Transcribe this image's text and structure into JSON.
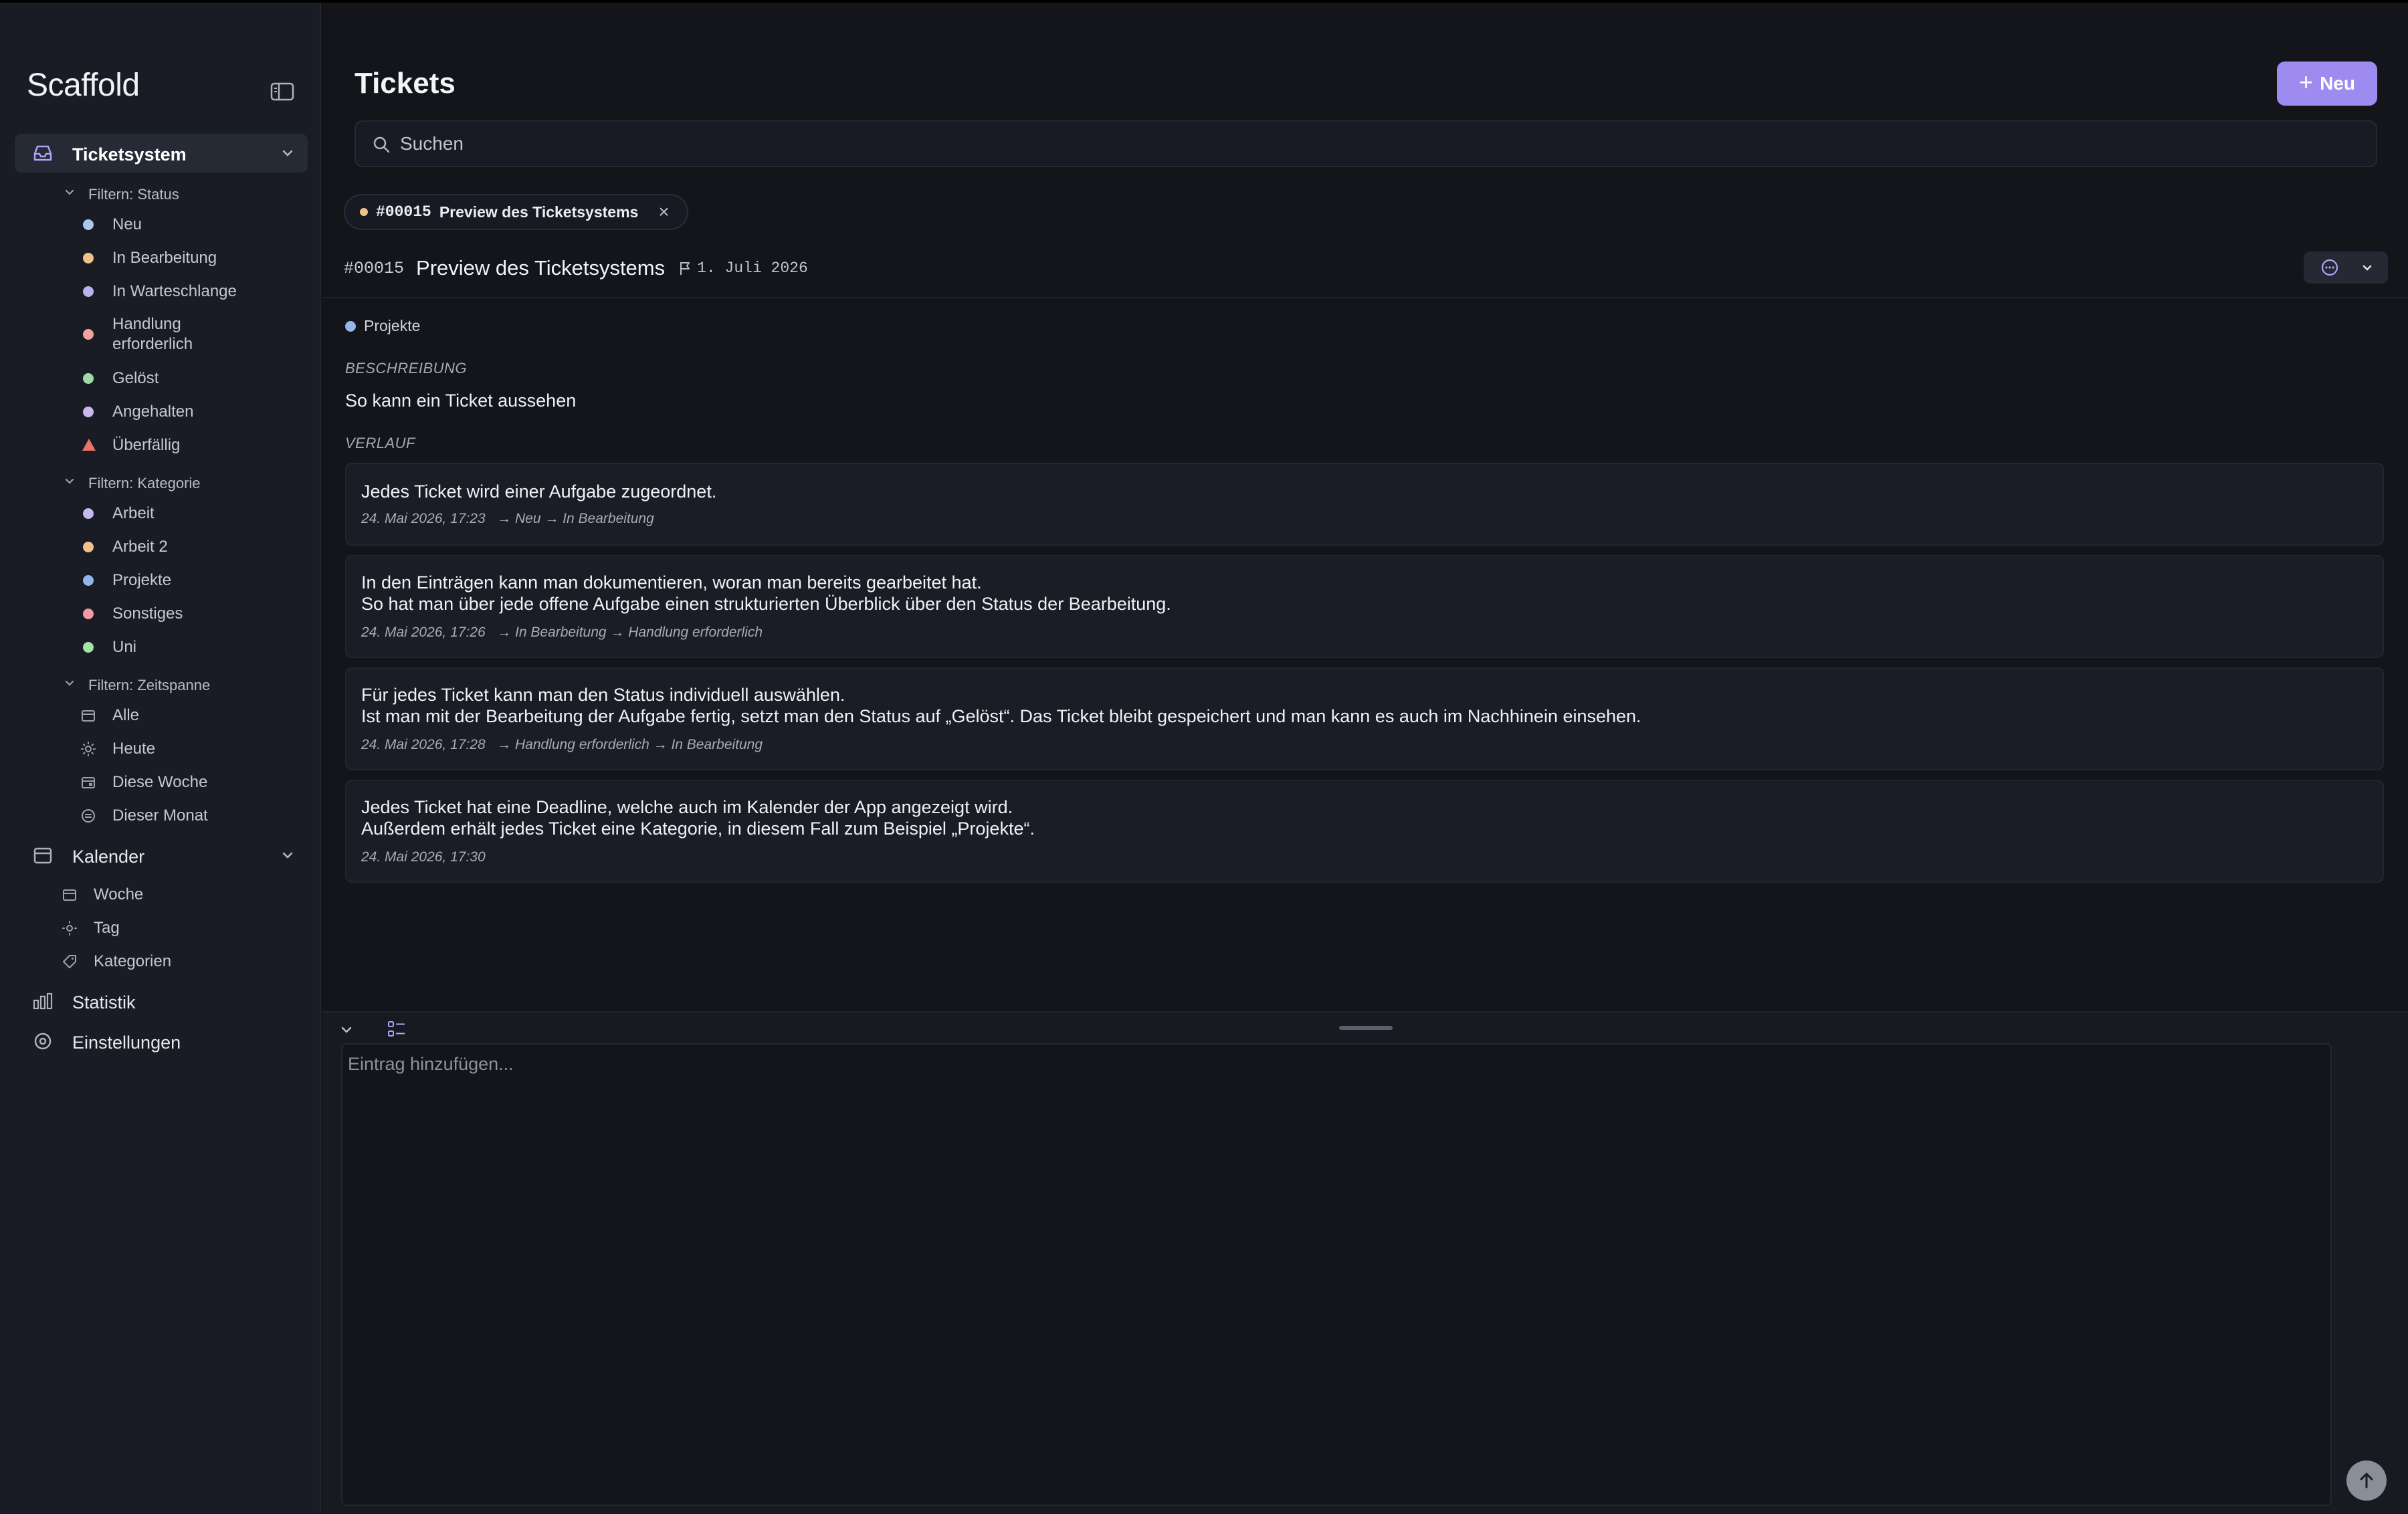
{
  "app": {
    "brand": "Scaffold"
  },
  "sidebar": {
    "main_items": [
      {
        "label": "Ticketsystem",
        "icon": "inbox-icon",
        "active": true
      },
      {
        "label": "Kalender",
        "icon": "calendar-icon"
      },
      {
        "label": "Statistik",
        "icon": "bar-chart-icon"
      },
      {
        "label": "Einstellungen",
        "icon": "settings-icon"
      }
    ],
    "groups": {
      "status": {
        "label": "Filtern: Status",
        "items": [
          {
            "label": "Neu",
            "color": "#a9c8ee"
          },
          {
            "label": "In Bearbeitung",
            "color": "#f0c28a"
          },
          {
            "label": "In Warteschlange",
            "color": "#b9b2ee"
          },
          {
            "label_line1": "Handlung",
            "label_line2": "erforderlich",
            "color": "#f0a49a"
          },
          {
            "label": "Gelöst",
            "color": "#9ed9a6"
          },
          {
            "label": "Angehalten",
            "color": "#c9b8ea"
          },
          {
            "label": "Überfällig",
            "icon": "warning-triangle-icon",
            "color": "#e8736a"
          }
        ]
      },
      "kategorie": {
        "label": "Filtern: Kategorie",
        "items": [
          {
            "label": "Arbeit",
            "color": "#c5b9ee"
          },
          {
            "label": "Arbeit 2",
            "color": "#f0c28a"
          },
          {
            "label": "Projekte",
            "color": "#8fb7e8"
          },
          {
            "label": "Sonstiges",
            "color": "#f29aa6"
          },
          {
            "label": "Uni",
            "color": "#a6e3a8"
          }
        ]
      },
      "zeitspanne": {
        "label": "Filtern: Zeitspanne",
        "items": [
          {
            "label": "Alle",
            "icon": "calendar-icon"
          },
          {
            "label": "Heute",
            "icon": "sun-icon"
          },
          {
            "label": "Diese Woche",
            "icon": "calendar-week-icon"
          },
          {
            "label": "Dieser Monat",
            "icon": "calendar-month-icon"
          }
        ]
      }
    },
    "kalender_items": [
      {
        "label": "Woche",
        "icon": "calendar-week-icon"
      },
      {
        "label": "Tag",
        "icon": "sun-icon"
      },
      {
        "label": "Kategorien",
        "icon": "tag-icon"
      }
    ]
  },
  "header": {
    "title": "Tickets",
    "new_button": "Neu",
    "new_icon": "+",
    "search_placeholder": "Suchen"
  },
  "tab_chip": {
    "id": "#00015",
    "title": "Preview des Ticketsystems",
    "close": "×"
  },
  "ticket": {
    "id": "#00015",
    "title": "Preview des Ticketsystems",
    "deadline": "1. Juli 2026",
    "category": "Projekte",
    "description_label": "BESCHREIBUNG",
    "description": "So kann ein Ticket aussehen",
    "history_label": "VERLAUF",
    "entries": [
      {
        "line1": "Jedes Ticket wird einer Aufgabe zugeordnet.",
        "timestamp": "24. Mai 2026, 17:23",
        "transition": "→  Neu → In Bearbeitung"
      },
      {
        "line1": "In den Einträgen kann man dokumentieren, woran man bereits gearbeitet hat.",
        "line2": "So hat man über jede offene Aufgabe einen strukturierten Überblick über den Status der Bearbeitung.",
        "timestamp": "24. Mai 2026, 17:26",
        "transition": "→  In Bearbeitung → Handlung erforderlich"
      },
      {
        "line1": "Für jedes Ticket kann man den Status individuell auswählen.",
        "line2": "Ist man mit der Bearbeitung der Aufgabe fertig, setzt man den Status auf „Gelöst“. Das Ticket bleibt gespeichert und man kann es auch im Nachhinein einsehen.",
        "timestamp": "24. Mai 2026, 17:28",
        "transition": "→  Handlung erforderlich → In Bearbeitung"
      },
      {
        "line1": "Jedes Ticket hat eine Deadline, welche auch im Kalender der App angezeigt wird.",
        "line2": "Außerdem erhält jedes Ticket eine Kategorie, in diesem Fall zum Beispiel „Projekte“.",
        "timestamp": "24. Mai 2026, 17:30"
      }
    ]
  },
  "composer": {
    "placeholder": "Eintrag hinzufügen..."
  },
  "colors": {
    "accent": "#9d8bf0",
    "background": "#13151b",
    "sidebar": "#191c25"
  }
}
